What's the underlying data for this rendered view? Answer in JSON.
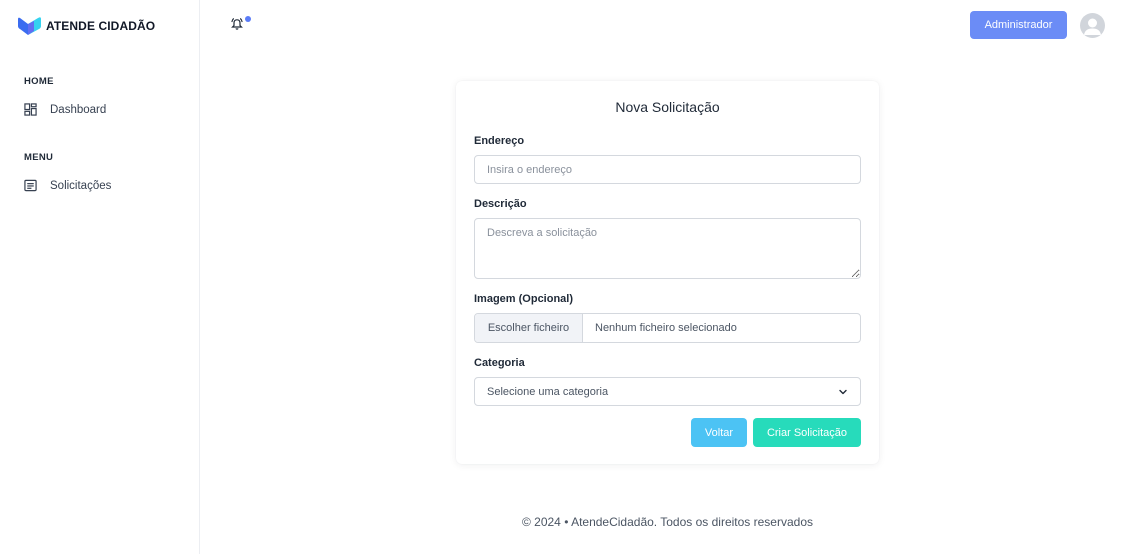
{
  "brand": {
    "name": "ATENDE CIDADÃO",
    "logo_icon": "brand-logo-icon"
  },
  "sidebar": {
    "sections": [
      {
        "label": "HOME",
        "items": [
          {
            "label": "Dashboard",
            "icon": "dashboard-grid-icon"
          }
        ]
      },
      {
        "label": "MENU",
        "items": [
          {
            "label": "Solicitações",
            "icon": "list-document-icon"
          }
        ]
      }
    ]
  },
  "topbar": {
    "notification_icon": "bell-icon",
    "has_unread_notification": true,
    "admin_label": "Administrador",
    "avatar_icon": "user-avatar-icon"
  },
  "form": {
    "title": "Nova Solicitação",
    "address": {
      "label": "Endereço",
      "placeholder": "Insira o endereço",
      "value": ""
    },
    "description": {
      "label": "Descrição",
      "placeholder": "Descreva a solicitação",
      "value": ""
    },
    "image": {
      "label": "Imagem (Opcional)",
      "button": "Escolher ficheiro",
      "status": "Nenhum ficheiro selecionado"
    },
    "category": {
      "label": "Categoria",
      "selected": "Selecione uma categoria",
      "icon": "chevron-down-icon"
    },
    "buttons": {
      "back": "Voltar",
      "create": "Criar Solicitação"
    }
  },
  "footer": {
    "text": "© 2024 • AtendeCidadão. Todos os direitos reservados"
  },
  "colors": {
    "primary": "#6b8cf6",
    "back_button": "#4cc3f4",
    "create_button": "#27dbbb",
    "logo_blue": "#3b6cf0",
    "logo_cyan": "#34d3f0",
    "notification_dot": "#5b7cf7"
  }
}
